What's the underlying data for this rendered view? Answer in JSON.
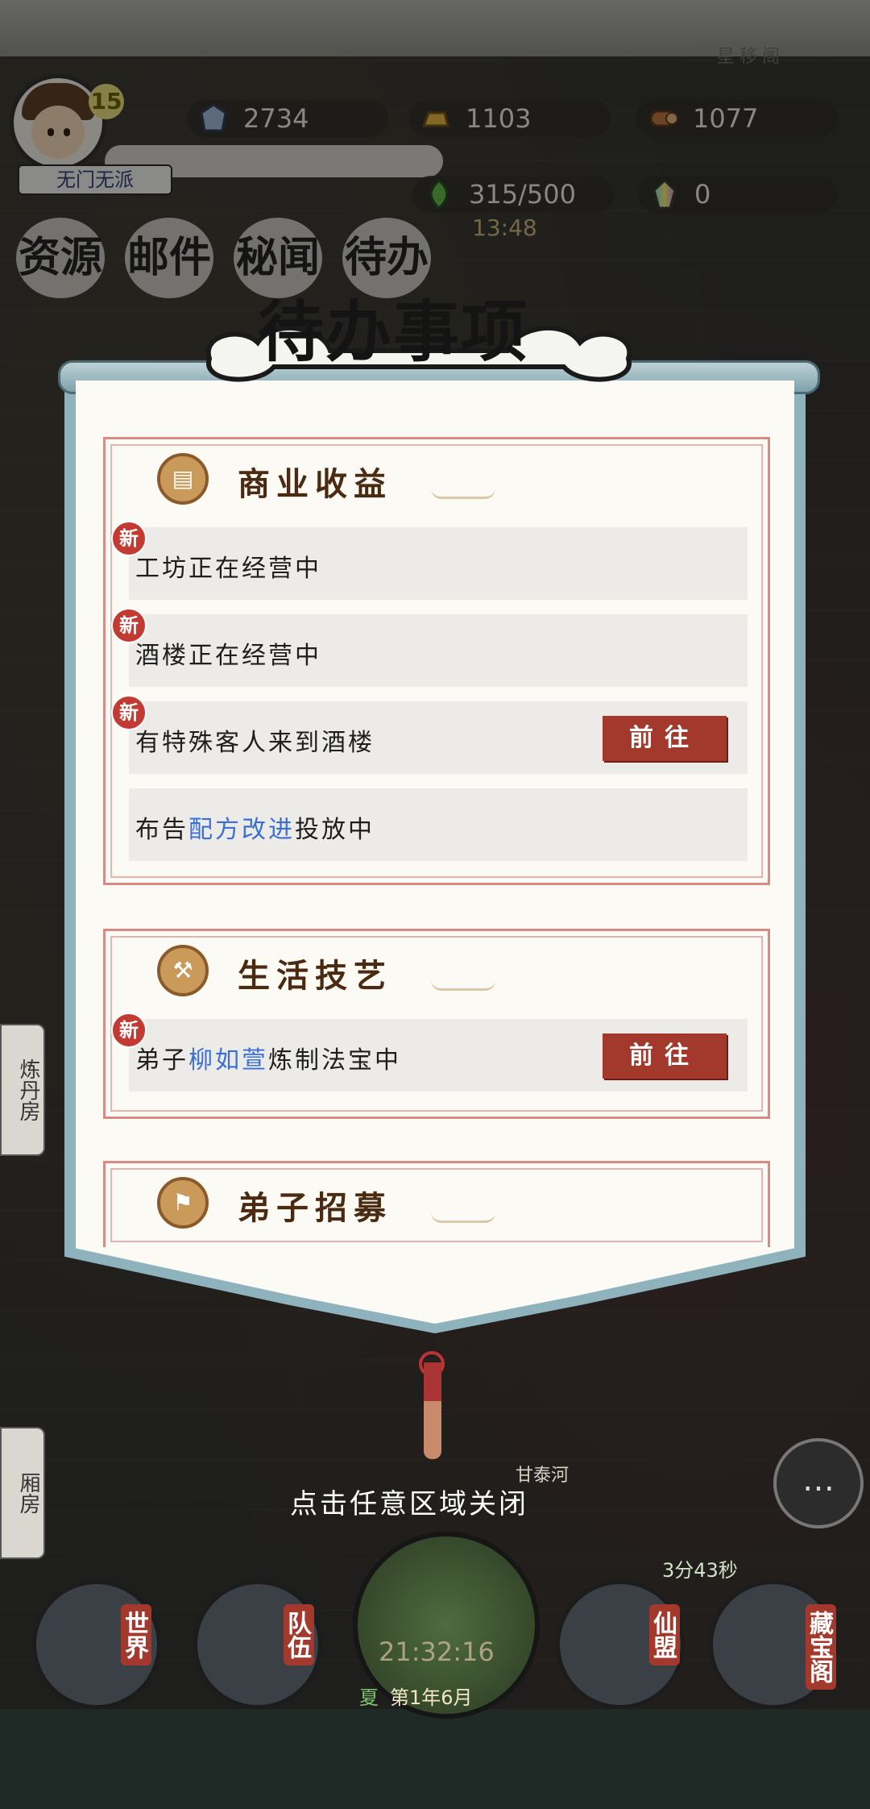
{
  "header": {
    "level": "15",
    "sect_name": "无门无派",
    "top_sign": "星移阁",
    "resources": [
      {
        "icon": "crystal-icon",
        "value": "2734"
      },
      {
        "icon": "gold-ingot-icon",
        "value": "1103"
      },
      {
        "icon": "wood-log-icon",
        "value": "1077"
      },
      {
        "icon": "spirit-gem-icon",
        "value": "315/500"
      },
      {
        "icon": "rainbow-crystal-icon",
        "value": "0"
      }
    ],
    "regen_timer": "13:48"
  },
  "tabs": [
    "资源",
    "邮件",
    "秘闻",
    "待办"
  ],
  "panel": {
    "title": "待办事项",
    "sections": [
      {
        "title": "商业收益",
        "items": [
          {
            "new_badge": "新",
            "text": "工坊正在经营中"
          },
          {
            "new_badge": "新",
            "text": "酒楼正在经营中"
          },
          {
            "new_badge": "新",
            "text": "有特殊客人来到酒楼",
            "button": "前往"
          },
          {
            "text_before": "布告",
            "highlight": "配方改进",
            "text_after": "投放中"
          }
        ]
      },
      {
        "title": "生活技艺",
        "items": [
          {
            "new_badge": "新",
            "text_before": "弟子",
            "highlight": "柳如萱",
            "text_after": "炼制法宝中",
            "button": "前往"
          }
        ]
      },
      {
        "title": "弟子招募"
      }
    ]
  },
  "close_hint": "点击任意区域关闭",
  "map": {
    "left_buildings": [
      "炼丹房",
      "厢房"
    ],
    "river_label": "甘泰河",
    "countdown": "3分43秒"
  },
  "dock": {
    "buttons": [
      "世界",
      "队伍",
      "仙盟",
      "藏宝阁"
    ],
    "clock": "21:32:16",
    "season": "夏",
    "date": "第1年6月"
  }
}
